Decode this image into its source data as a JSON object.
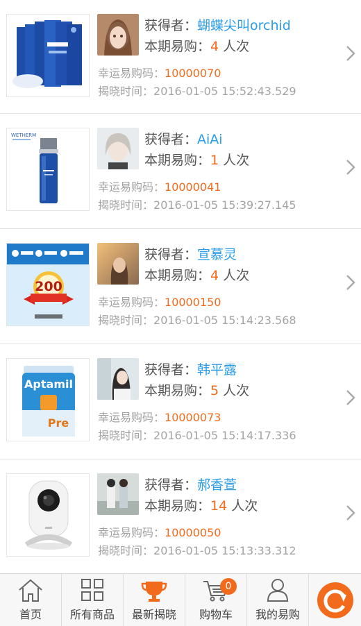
{
  "labels": {
    "winner_prefix": "获得者：",
    "purchase_prefix": "本期易购：",
    "purchase_suffix": "人次",
    "code_prefix": "幸运易购码：",
    "time_prefix": "揭晓时间："
  },
  "items": [
    {
      "winner": "蝴蝶尖叫orchid",
      "count": "4",
      "code": "10000070",
      "time": "2016-01-05 15:52:43.529",
      "product_icon": "face-mask-box-image",
      "avatar_icon": "doll-portrait-avatar"
    },
    {
      "winner": "AiAi",
      "count": "1",
      "code": "10000041",
      "time": "2016-01-05 15:39:27.145",
      "product_icon": "serum-bottle-image",
      "product_brand": "WETHERM",
      "avatar_icon": "girl-portrait-avatar"
    },
    {
      "winner": "宣慕灵",
      "count": "4",
      "code": "10000150",
      "time": "2016-01-05 15:14:23.568",
      "product_icon": "phone-recharge-card-image",
      "product_value": "200",
      "avatar_icon": "sunset-portrait-avatar"
    },
    {
      "winner": "韩平露",
      "count": "5",
      "code": "10000073",
      "time": "2016-01-05 15:14:17.336",
      "product_icon": "milk-powder-can-image",
      "product_brand": "Aptamil",
      "product_sub": "Pre",
      "avatar_icon": "girl-reading-avatar"
    },
    {
      "winner": "郝香萱",
      "count": "14",
      "code": "10000050",
      "time": "2016-01-05 15:13:33.312",
      "product_icon": "smart-camera-image",
      "avatar_icon": "couple-portrait-avatar"
    }
  ],
  "tabbar": {
    "home": "首页",
    "all_products": "所有商品",
    "latest": "最新揭晓",
    "cart": "购物车",
    "cart_count": "0",
    "mine": "我的易购"
  },
  "colors": {
    "accent": "#f26b1d",
    "link": "#2b9de8"
  }
}
